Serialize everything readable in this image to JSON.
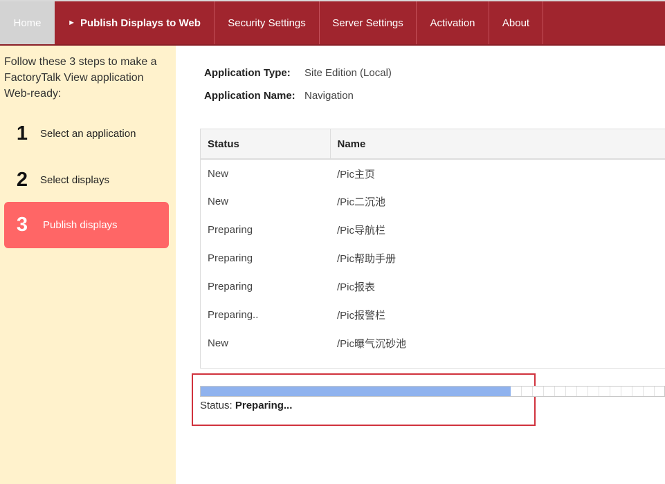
{
  "nav": {
    "home": "Home",
    "publish_arrow": "►",
    "publish": "Publish Displays to Web",
    "security": "Security Settings",
    "server": "Server Settings",
    "activation": "Activation",
    "about": "About"
  },
  "sidebar": {
    "intro": "Follow these 3 steps to make a FactoryTalk View application Web-ready:",
    "steps": [
      {
        "num": "1",
        "label": "Select an application"
      },
      {
        "num": "2",
        "label": "Select displays"
      },
      {
        "num": "3",
        "label": "Publish displays"
      }
    ]
  },
  "app": {
    "type_label": "Application Type:",
    "type_value": "Site Edition (Local)",
    "name_label": "Application Name:",
    "name_value": "Navigation"
  },
  "table": {
    "headers": [
      "Status",
      "Name"
    ],
    "rows": [
      {
        "status": "New",
        "name": "/Pic主页"
      },
      {
        "status": "New",
        "name": "/Pic二沉池"
      },
      {
        "status": "Preparing",
        "name": "/Pic导航栏"
      },
      {
        "status": "Preparing",
        "name": "/Pic帮助手册"
      },
      {
        "status": "Preparing",
        "name": "/Pic报表"
      },
      {
        "status": "Preparing..",
        "name": "/Pic报警栏"
      },
      {
        "status": "New",
        "name": "/Pic曝气沉砂池"
      }
    ]
  },
  "progress": {
    "fraction": 0.668,
    "status_label": "Status:",
    "status_value": "Preparing..."
  },
  "colors": {
    "nav_bg": "#a0252e",
    "home_tab_bg": "#d3d3d3",
    "sidebar_bg": "#fff2cc",
    "active_step_bg": "#ff6666",
    "progress_fill": "#8fb2ee",
    "highlight_border": "#d0323d"
  }
}
